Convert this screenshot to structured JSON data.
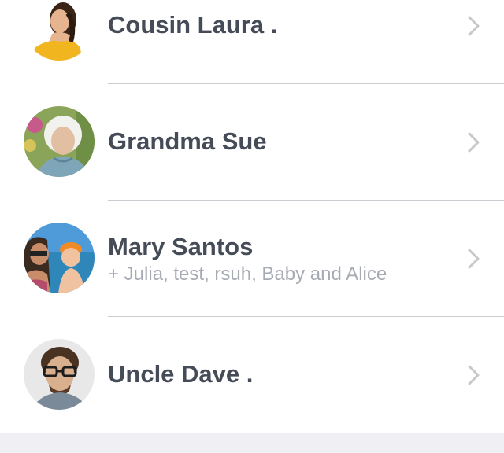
{
  "contacts": [
    {
      "name": "Cousin Laura .",
      "subtitle": "",
      "avatar": "woman-yellow-top-photo"
    },
    {
      "name": "Grandma Sue",
      "subtitle": "",
      "avatar": "elderly-woman-photo"
    },
    {
      "name": "Mary Santos",
      "subtitle": "+ Julia, test, rsuh, Baby and Alice",
      "avatar": "mother-and-child-beach-photo"
    },
    {
      "name": "Uncle Dave .",
      "subtitle": "",
      "avatar": "man-glasses-photo"
    }
  ],
  "icons": {
    "row_action": "chevron-right-icon"
  },
  "colors": {
    "name_text": "#454c58",
    "subtitle_text": "#a6aab2",
    "divider": "#c9ccd1",
    "chevron": "#c7c7cc",
    "footer_bg": "#efeff4"
  }
}
